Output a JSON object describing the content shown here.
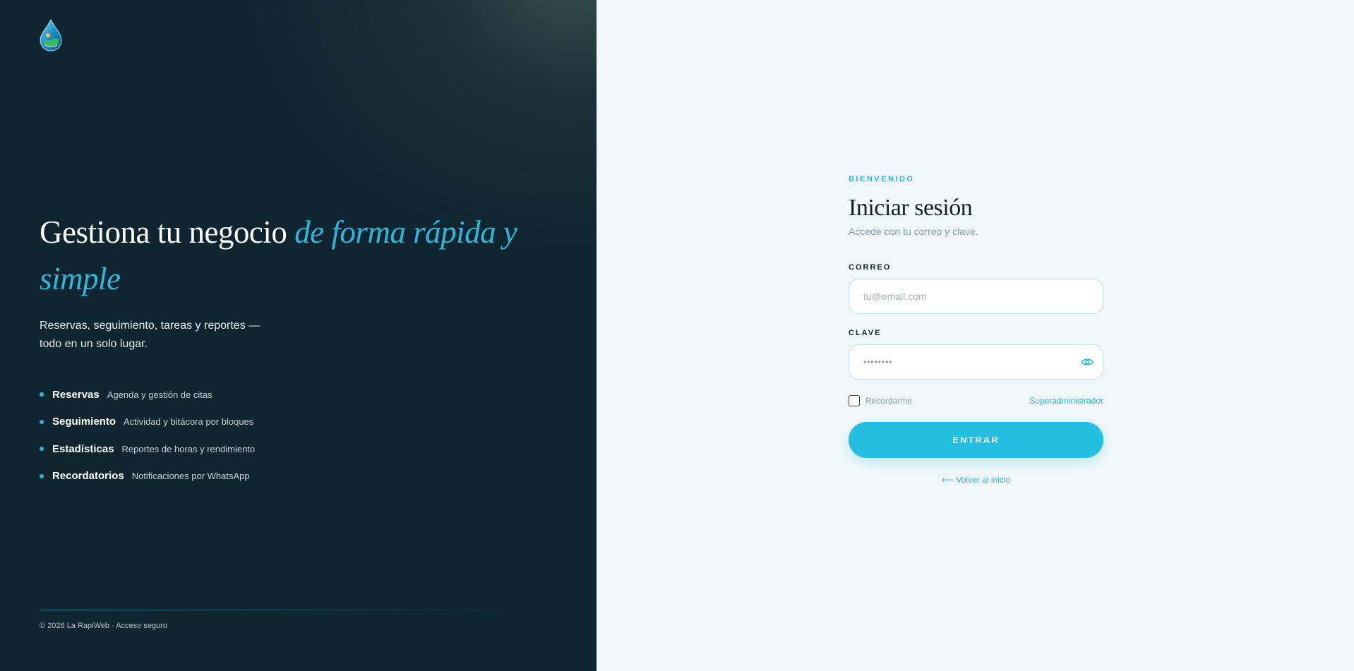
{
  "brand": {
    "logo_icon": "water-drop-logo-icon",
    "accent_color": "#2bb8dc",
    "left_bg": "#0f2530",
    "right_bg": "#f1f8fb"
  },
  "hero": {
    "headline_plain": "Gestiona tu negocio ",
    "headline_accent": "de forma rápida y simple",
    "subtitle": "Reservas, seguimiento, tareas y reportes — todo en un solo lugar."
  },
  "features": [
    {
      "title": "Reservas",
      "desc": "Agenda y gestión de citas"
    },
    {
      "title": "Seguimiento",
      "desc": "Actividad y bitácora por bloques"
    },
    {
      "title": "Estadísticas",
      "desc": "Reportes de horas y rendimiento"
    },
    {
      "title": "Recordatorios",
      "desc": "Notificaciones por WhatsApp"
    }
  ],
  "footer": {
    "text": "© 2026 La RapiWeb · Acceso seguro"
  },
  "login": {
    "eyebrow": "BIENVENIDO",
    "title": "Iniciar sesión",
    "subtitle": "Accede con tu correo y clave.",
    "email_label": "CORREO",
    "email_placeholder": "tu@email.com",
    "password_label": "CLAVE",
    "password_value": "••••••••",
    "password_toggle_icon": "eye-icon",
    "remember_label": "Recordarme",
    "superadmin_link": "Superadministrador",
    "submit_label": "ENTRAR",
    "back_link": "⟵ Volver al inicio"
  }
}
